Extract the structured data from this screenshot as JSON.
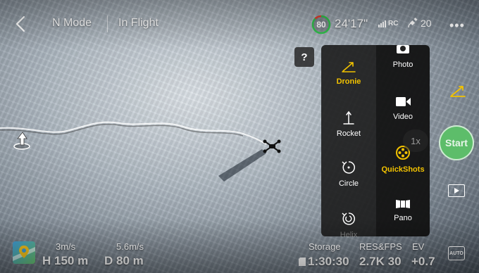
{
  "top_bar": {
    "mode": "N Mode",
    "flight_status": "In Flight",
    "battery_percent": "80",
    "flight_time": "24'17\"",
    "rc_label": "RC",
    "satellite_count": "20",
    "more_symbol": "•••"
  },
  "help_label": "?",
  "quickshots": {
    "items": [
      {
        "label": "Dronie",
        "icon": "dronie-icon",
        "active": true
      },
      {
        "label": "Rocket",
        "icon": "rocket-icon",
        "active": false
      },
      {
        "label": "Circle",
        "icon": "circle-icon",
        "active": false
      },
      {
        "label": "Helix",
        "icon": "helix-icon",
        "active": false
      }
    ]
  },
  "capture_modes": {
    "items": [
      {
        "label": "Photo",
        "icon": "camera-icon",
        "active": false
      },
      {
        "label": "Video",
        "icon": "video-camera-icon",
        "active": false
      },
      {
        "label": "QuickShots",
        "icon": "film-reel-icon",
        "active": true
      },
      {
        "label": "Pano",
        "icon": "panorama-icon",
        "active": false
      }
    ]
  },
  "zoom_label": "1x",
  "start_label": "Start",
  "telemetry": {
    "vertical_speed": "3m/s",
    "horizontal_speed": "5.6m/s",
    "height": "H 150 m",
    "distance": "D 80 m"
  },
  "camera_settings": {
    "storage_label": "Storage",
    "storage_value": "1:30:30",
    "res_label": "RES&FPS",
    "res_value": "2.7K 30",
    "ev_label": "EV",
    "ev_value": "+0.7",
    "auto_label": "AUTO"
  },
  "colors": {
    "accent_yellow": "#f2c200",
    "start_green": "#5dbd6a",
    "battery_green": "#2fc14a",
    "battery_red": "#e63b2e"
  }
}
